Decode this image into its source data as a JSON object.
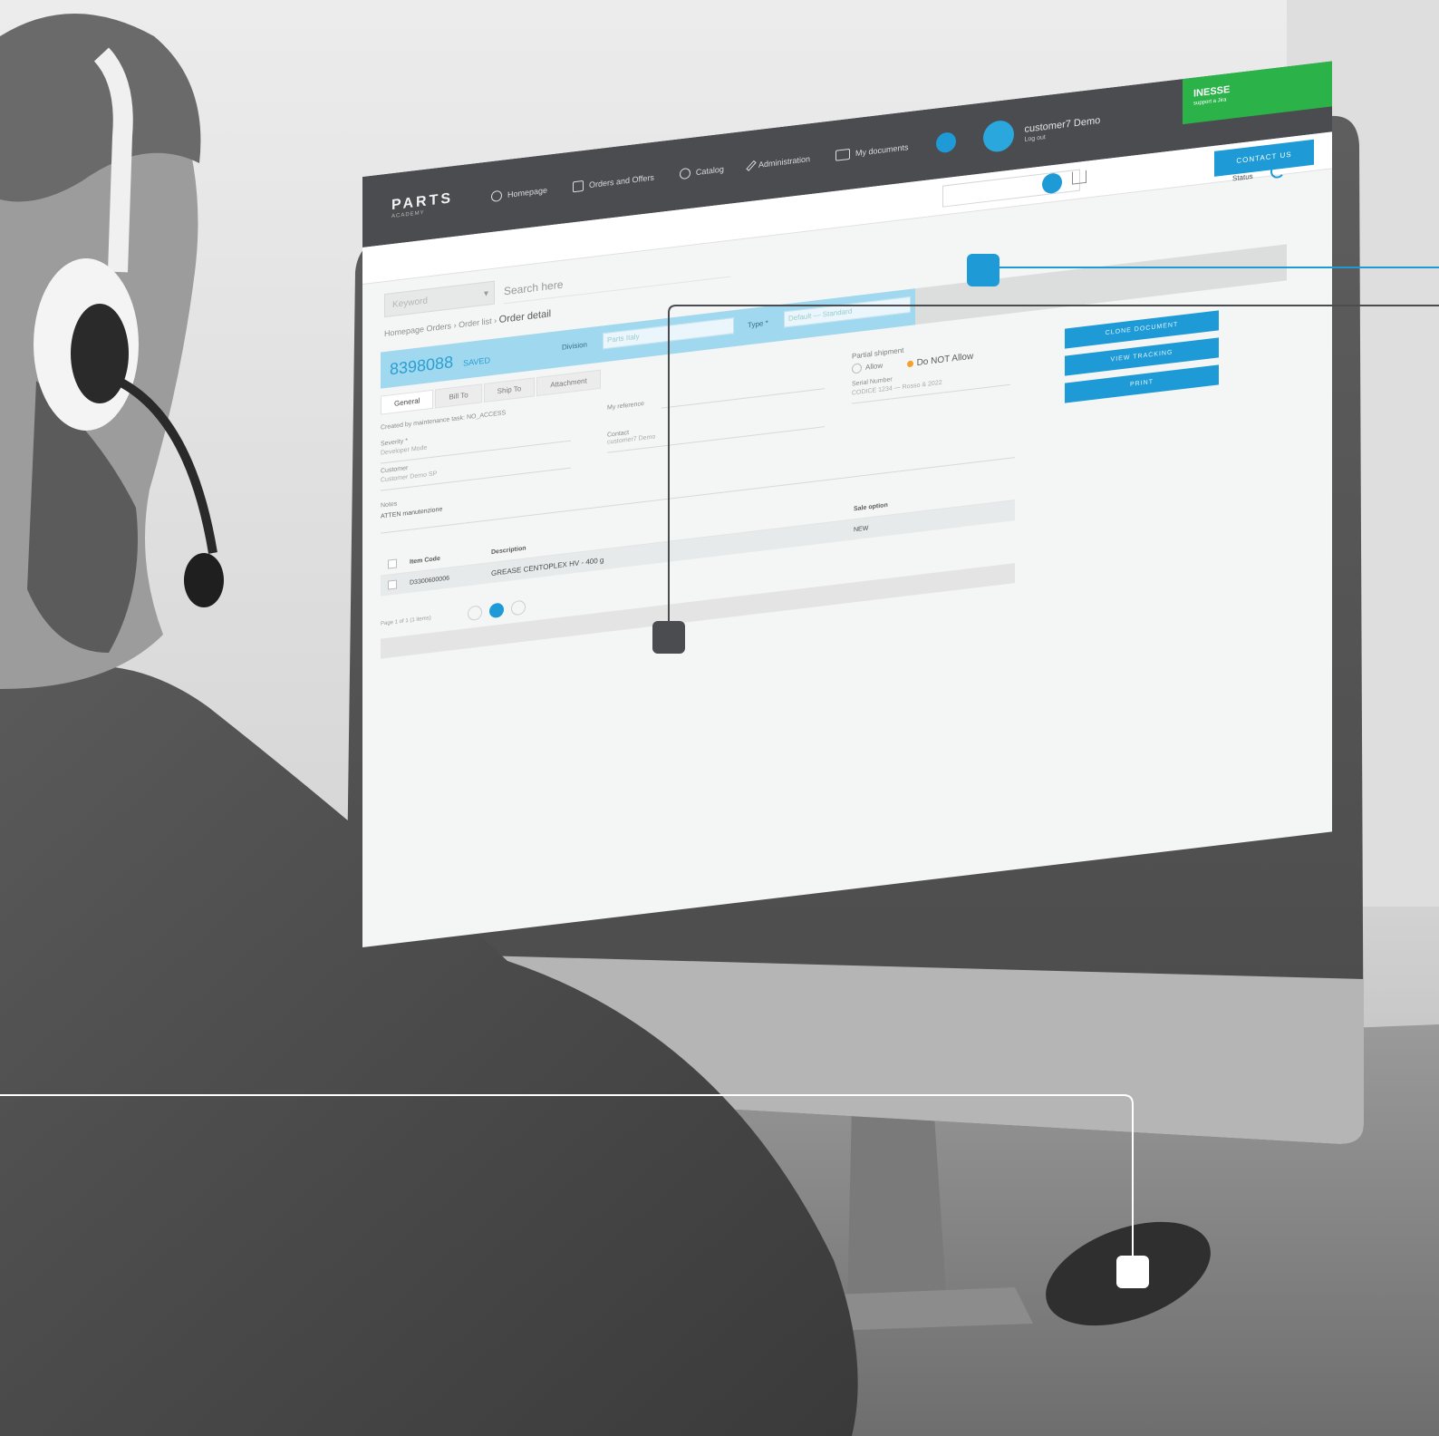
{
  "colors": {
    "accent": "#1e9ad6",
    "topbar": "#4a4c4f",
    "brand_green": "#2bb34a",
    "order_highlight": "#9fd8ef",
    "orange_radio": "#f3a12b"
  },
  "app": {
    "logo": "PARTS",
    "logo_sub": "ACADEMY"
  },
  "nav": {
    "items": [
      {
        "label": "Homepage",
        "icon": "home-icon"
      },
      {
        "label": "Orders and Offers",
        "icon": "orders-icon"
      },
      {
        "label": "Catalog",
        "icon": "catalog-icon"
      },
      {
        "label": "Administration",
        "icon": "wrench-icon"
      },
      {
        "label": "My documents",
        "icon": "documents-icon"
      }
    ],
    "globe_icon": "globe-icon"
  },
  "user": {
    "name": "customer7 Demo",
    "logout": "Log out"
  },
  "brand": {
    "name": "INESSE",
    "sub": "support a Jira"
  },
  "header": {
    "contact_label": "CONTACT US"
  },
  "search": {
    "keyword_placeholder": "Keyword",
    "placeholder": "Search here"
  },
  "status": {
    "label": "Status"
  },
  "breadcrumb": {
    "root": "Homepage",
    "mid": "Orders",
    "sep1": "›",
    "section": "Order list",
    "sep2": "›",
    "current": "Order detail"
  },
  "order": {
    "number": "8398088",
    "state": "SAVED",
    "division_label": "Division",
    "division_value": "Parts Italy",
    "type_label": "Type *",
    "type_value": "Default — Standard"
  },
  "tabs": [
    {
      "label": "General",
      "active": true
    },
    {
      "label": "Bill To",
      "active": false
    },
    {
      "label": "Ship To",
      "active": false
    },
    {
      "label": "Attachment",
      "active": false
    }
  ],
  "form": {
    "maintenance_check": "Created by maintenance task: NO_ACCESS",
    "severity_label": "Severity *",
    "severity_value": "Developer Mode",
    "customer_label": "Customer",
    "customer_value": "Customer Demo SP",
    "my_reference_label": "My reference",
    "contact_label": "Contact",
    "contact_value": "customer7 Demo",
    "serial_label": "Serial Number",
    "serial_value": "CODICE 1234 — Rosso & 2022"
  },
  "partial_shipment": {
    "title": "Partial shipment",
    "allow": "Allow",
    "do_not_allow": "Do NOT Allow"
  },
  "actions": {
    "clone": "CLONE DOCUMENT",
    "tracking": "VIEW TRACKING",
    "print": "PRINT"
  },
  "notes": {
    "label": "Notes",
    "value": "ATTEN manutenzione"
  },
  "table": {
    "headers": [
      "Item Code",
      "Description",
      "Sale option"
    ],
    "rows": [
      {
        "code": "D3300600006",
        "description": "GREASE CENTOPLEX HV - 400 g",
        "option": "NEW"
      }
    ]
  },
  "pager": {
    "text": "Page 1 of 1 (1 items)",
    "current": "1"
  },
  "scene": {
    "person_icon": "headset-icon",
    "mouse_icon": "mouse-icon"
  }
}
